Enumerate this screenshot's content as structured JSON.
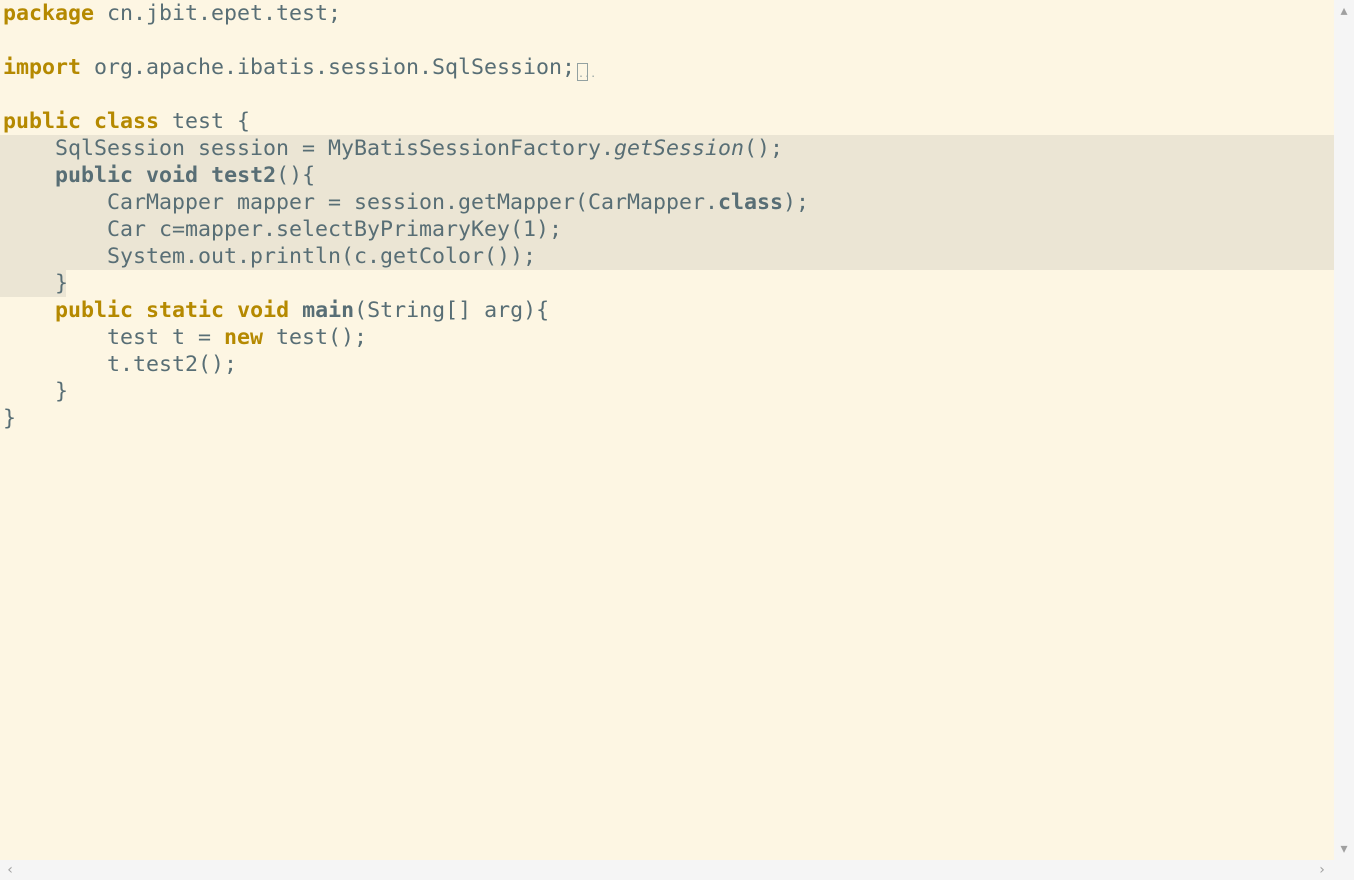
{
  "editor": {
    "lines": {
      "l1_kw": "package",
      "l1_rest": " cn.jbit.epet.test;",
      "l3_kw": "import",
      "l3_rest": " org.apache.ibatis.session.SqlSession;",
      "l3_fold": "...",
      "l5_kw1": "public",
      "l5_kw2": "class",
      "l5_rest": " test {",
      "l6_a": "    SqlSession session = MyBatisSessionFactory.",
      "l6_b": "getSession",
      "l6_c": "();",
      "l7_a": "    ",
      "l7_kw1": "public",
      "l7_kw2": "void",
      "l7_name": "test2",
      "l7_rest": "(){",
      "l8_a": "        CarMapper mapper = session.getMapper(CarMapper.",
      "l8_b": "class",
      "l8_c": ");",
      "l9": "        Car c=mapper.selectByPrimaryKey(1);",
      "l10": "        System.out.println(c.getColor());",
      "l11": "    }",
      "l12_a": "    ",
      "l12_kw1": "public",
      "l12_kw2": "static",
      "l12_kw3": "void",
      "l12_name": "main",
      "l12_rest": "(String[] arg){",
      "l13_a": "        test t = ",
      "l13_kw": "new",
      "l13_rest": " test();",
      "l14": "        t.test2();",
      "l15": "    }",
      "l16": "}"
    }
  },
  "scrollbars": {
    "up_icon": "▴",
    "down_icon": "▾",
    "left_icon": "‹",
    "right_icon": "›"
  },
  "colors": {
    "background": "#fdf6e3",
    "highlight": "#ebe5d4",
    "keyword": "#b58900",
    "text": "#586e75"
  }
}
